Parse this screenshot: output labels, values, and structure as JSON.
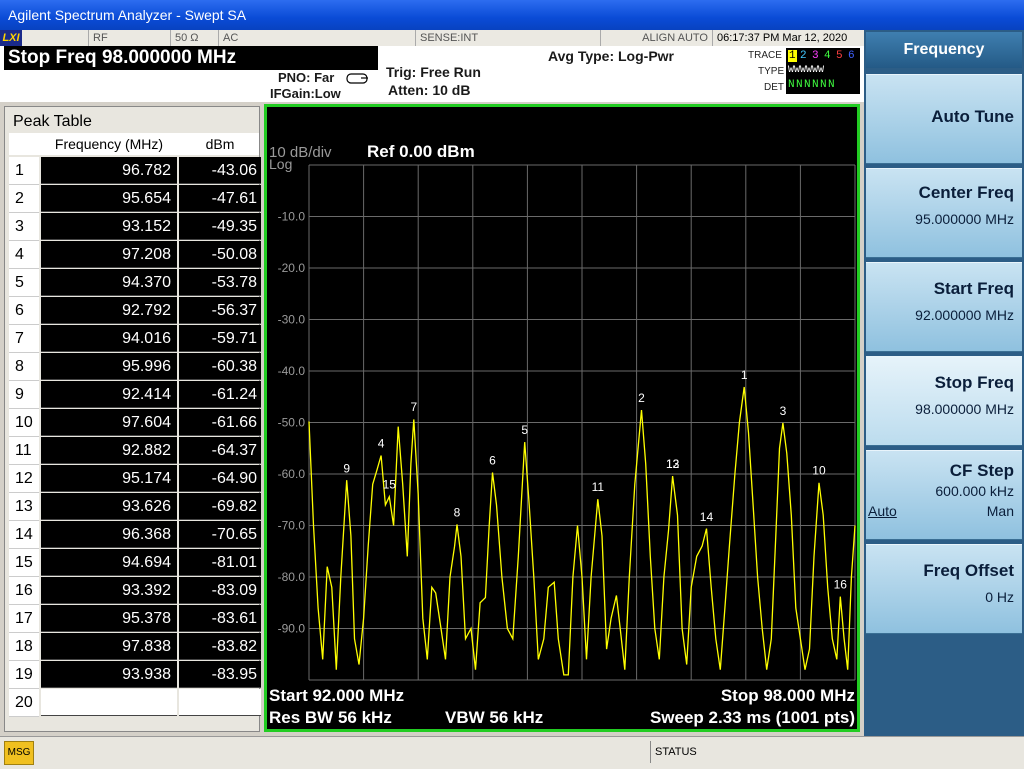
{
  "window": {
    "title": "Agilent Spectrum Analyzer - Swept SA"
  },
  "status_bar": {
    "rf": "RF",
    "impedance": "50 Ω",
    "coupling": "AC",
    "sense": "SENSE:INT",
    "align": "ALIGN AUTO",
    "datetime": "06:17:37 PM Mar 12, 2020"
  },
  "info": {
    "stop_freq": "Stop Freq  98.000000 MHz",
    "pno": "PNO: Far",
    "ifgain": "IFGain:Low",
    "trig": "Trig: Free Run",
    "atten": "Atten: 10 dB",
    "avg_type": "Avg Type: Log-Pwr",
    "trace_label": "TRACE",
    "type_label": "TYPE",
    "det_label": "DET",
    "trace_nums": [
      "1",
      "2",
      "3",
      "4",
      "5",
      "6"
    ],
    "trace_colors": [
      "#ffff00",
      "#40c8ff",
      "#ff40ff",
      "#40ff40",
      "#ff4040",
      "#4060ff"
    ],
    "type_row": "WWWWWW",
    "det_row": "NNNNNN"
  },
  "peak_table": {
    "title": "Peak Table",
    "col_freq": "Frequency (MHz)",
    "col_db": "dBm",
    "rows": [
      {
        "idx": "1",
        "freq": "96.782",
        "db": "-43.06"
      },
      {
        "idx": "2",
        "freq": "95.654",
        "db": "-47.61"
      },
      {
        "idx": "3",
        "freq": "93.152",
        "db": "-49.35"
      },
      {
        "idx": "4",
        "freq": "97.208",
        "db": "-50.08"
      },
      {
        "idx": "5",
        "freq": "94.370",
        "db": "-53.78"
      },
      {
        "idx": "6",
        "freq": "92.792",
        "db": "-56.37"
      },
      {
        "idx": "7",
        "freq": "94.016",
        "db": "-59.71"
      },
      {
        "idx": "8",
        "freq": "95.996",
        "db": "-60.38"
      },
      {
        "idx": "9",
        "freq": "92.414",
        "db": "-61.24"
      },
      {
        "idx": "10",
        "freq": "97.604",
        "db": "-61.66"
      },
      {
        "idx": "11",
        "freq": "92.882",
        "db": "-64.37"
      },
      {
        "idx": "12",
        "freq": "95.174",
        "db": "-64.90"
      },
      {
        "idx": "13",
        "freq": "93.626",
        "db": "-69.82"
      },
      {
        "idx": "14",
        "freq": "96.368",
        "db": "-70.65"
      },
      {
        "idx": "15",
        "freq": "94.694",
        "db": "-81.01"
      },
      {
        "idx": "16",
        "freq": "93.392",
        "db": "-83.09"
      },
      {
        "idx": "17",
        "freq": "95.378",
        "db": "-83.61"
      },
      {
        "idx": "18",
        "freq": "97.838",
        "db": "-83.82"
      },
      {
        "idx": "19",
        "freq": "93.938",
        "db": "-83.95"
      },
      {
        "idx": "20",
        "freq": "",
        "db": ""
      }
    ]
  },
  "plot": {
    "scale_div": "10 dB/div",
    "scale_type": "Log",
    "ref_level": "Ref 0.00 dBm",
    "start": "Start 92.000 MHz",
    "stop": "Stop 98.000 MHz",
    "rbw": "Res BW 56 kHz",
    "vbw": "VBW 56 kHz",
    "sweep": "Sweep  2.33 ms (1001 pts)"
  },
  "softkeys": {
    "header": "Frequency",
    "auto_tune": "Auto Tune",
    "center_freq": "Center Freq",
    "center_val": "95.000000 MHz",
    "start_freq": "Start Freq",
    "start_val": "92.000000 MHz",
    "stop_freq": "Stop Freq",
    "stop_val": "98.000000 MHz",
    "cf_step": "CF Step",
    "cf_val": "600.000 kHz",
    "cf_auto": "Auto",
    "cf_man": "Man",
    "freq_offset": "Freq Offset",
    "offset_val": "0 Hz"
  },
  "message_bar": {
    "msg": "MSG",
    "status": "STATUS"
  },
  "chart_data": {
    "type": "line",
    "title": "",
    "xlabel": "",
    "ylabel": "",
    "xlim": [
      92.0,
      98.0
    ],
    "ylim": [
      -100,
      0
    ],
    "y_ticks": [
      -10,
      -20,
      -30,
      -40,
      -50,
      -60,
      -70,
      -80,
      -90
    ],
    "y_tick_labels": [
      "-10.0",
      "-20.0",
      "-30.0",
      "-40.0",
      "-50.0",
      "-60.0",
      "-70.0",
      "-80.0",
      "-90.0"
    ],
    "grid": true,
    "series": [
      {
        "color": "#ffff00",
        "x": [
          92.0,
          92.05,
          92.1,
          92.15,
          92.2,
          92.25,
          92.3,
          92.35,
          92.414,
          92.46,
          92.5,
          92.55,
          92.6,
          92.65,
          92.7,
          92.75,
          92.792,
          92.84,
          92.882,
          92.93,
          92.98,
          93.03,
          93.08,
          93.12,
          93.152,
          93.2,
          93.25,
          93.3,
          93.35,
          93.392,
          93.45,
          93.5,
          93.55,
          93.6,
          93.626,
          93.67,
          93.72,
          93.78,
          93.83,
          93.88,
          93.938,
          93.98,
          94.016,
          94.06,
          94.12,
          94.18,
          94.24,
          94.3,
          94.37,
          94.42,
          94.47,
          94.52,
          94.58,
          94.63,
          94.694,
          94.74,
          94.8,
          94.85,
          94.9,
          94.95,
          95.0,
          95.05,
          95.1,
          95.174,
          95.22,
          95.27,
          95.32,
          95.378,
          95.42,
          95.47,
          95.52,
          95.58,
          95.654,
          95.7,
          95.75,
          95.8,
          95.85,
          95.9,
          95.95,
          95.996,
          96.05,
          96.1,
          96.15,
          96.2,
          96.26,
          96.32,
          96.368,
          96.42,
          96.47,
          96.52,
          96.57,
          96.62,
          96.68,
          96.73,
          96.782,
          96.83,
          96.88,
          96.93,
          96.98,
          97.03,
          97.08,
          97.13,
          97.17,
          97.208,
          97.25,
          97.3,
          97.35,
          97.4,
          97.45,
          97.5,
          97.55,
          97.604,
          97.65,
          97.7,
          97.75,
          97.8,
          97.838,
          97.88,
          97.92,
          97.96,
          98.0
        ],
        "y": [
          -49.8,
          -70,
          -86,
          -96,
          -78,
          -82,
          -98,
          -80,
          -61.2,
          -72,
          -92,
          -97,
          -88,
          -74,
          -62,
          -59,
          -56.4,
          -66,
          -64.4,
          -70,
          -50.8,
          -62,
          -76,
          -58,
          -49.4,
          -64,
          -88,
          -96,
          -82,
          -83.1,
          -90,
          -96,
          -80,
          -74,
          -69.8,
          -76,
          -92,
          -90,
          -98,
          -85,
          -84,
          -70,
          -59.7,
          -66,
          -80,
          -90,
          -92,
          -76,
          -53.8,
          -66,
          -80,
          -96,
          -92,
          -82,
          -81,
          -92,
          -99,
          -99,
          -80,
          -70,
          -80,
          -96,
          -80,
          -64.9,
          -72,
          -94,
          -88,
          -83.6,
          -90,
          -98,
          -80,
          -62,
          -47.6,
          -58,
          -76,
          -90,
          -96,
          -80,
          -71,
          -60.4,
          -68,
          -90,
          -97,
          -82,
          -76,
          -74,
          -70.6,
          -82,
          -92,
          -98,
          -86,
          -74,
          -60,
          -50,
          -43.1,
          -52,
          -66,
          -80,
          -90,
          -98,
          -92,
          -72,
          -55,
          -50.1,
          -56,
          -68,
          -86,
          -92,
          -98,
          -94,
          -76,
          -61.7,
          -68,
          -82,
          -92,
          -96,
          -83.8,
          -92,
          -98,
          -80,
          -70
        ]
      }
    ],
    "markers": [
      {
        "label": "1",
        "x": 96.782,
        "y": -43.06
      },
      {
        "label": "2",
        "x": 95.654,
        "y": -47.61
      },
      {
        "label": "3",
        "x": 97.208,
        "y": -50.08
      },
      {
        "label": "4",
        "x": 92.792,
        "y": -56.37
      },
      {
        "label": "5",
        "x": 94.37,
        "y": -53.78
      },
      {
        "label": "6",
        "x": 94.016,
        "y": -59.71
      },
      {
        "label": "7",
        "x": 93.152,
        "y": -49.35
      },
      {
        "label": "8",
        "x": 93.626,
        "y": -69.82
      },
      {
        "label": "9",
        "x": 92.414,
        "y": -61.24
      },
      {
        "label": "10",
        "x": 97.604,
        "y": -61.66
      },
      {
        "label": "11",
        "x": 95.174,
        "y": -64.9
      },
      {
        "label": "12",
        "x": 95.996,
        "y": -60.38
      },
      {
        "label": "13",
        "x": 95.996,
        "y": -60.38
      },
      {
        "label": "14",
        "x": 96.368,
        "y": -70.65
      },
      {
        "label": "15",
        "x": 92.882,
        "y": -64.37
      },
      {
        "label": "16",
        "x": 97.838,
        "y": -83.82
      }
    ]
  }
}
